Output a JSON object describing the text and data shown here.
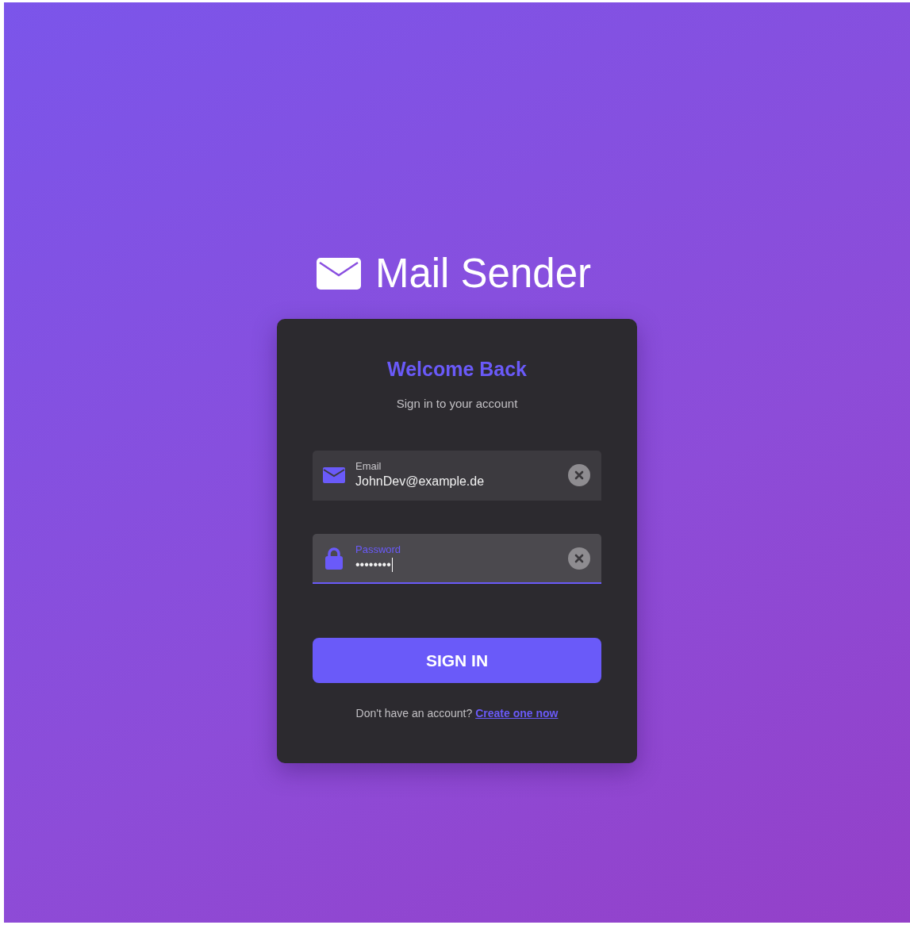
{
  "app": {
    "title": "Mail Sender"
  },
  "card": {
    "heading": "Welcome Back",
    "subtitle": "Sign in to your account"
  },
  "fields": [
    {
      "kind": "email",
      "label": "Email",
      "value": "JohnDev@example.de",
      "focused": false
    },
    {
      "kind": "password",
      "label": "Password",
      "value": "••••••••",
      "focused": true
    }
  ],
  "submit": {
    "label": "SIGN IN"
  },
  "footer": {
    "text": "Don't have an account?",
    "link": "Create one now"
  }
}
